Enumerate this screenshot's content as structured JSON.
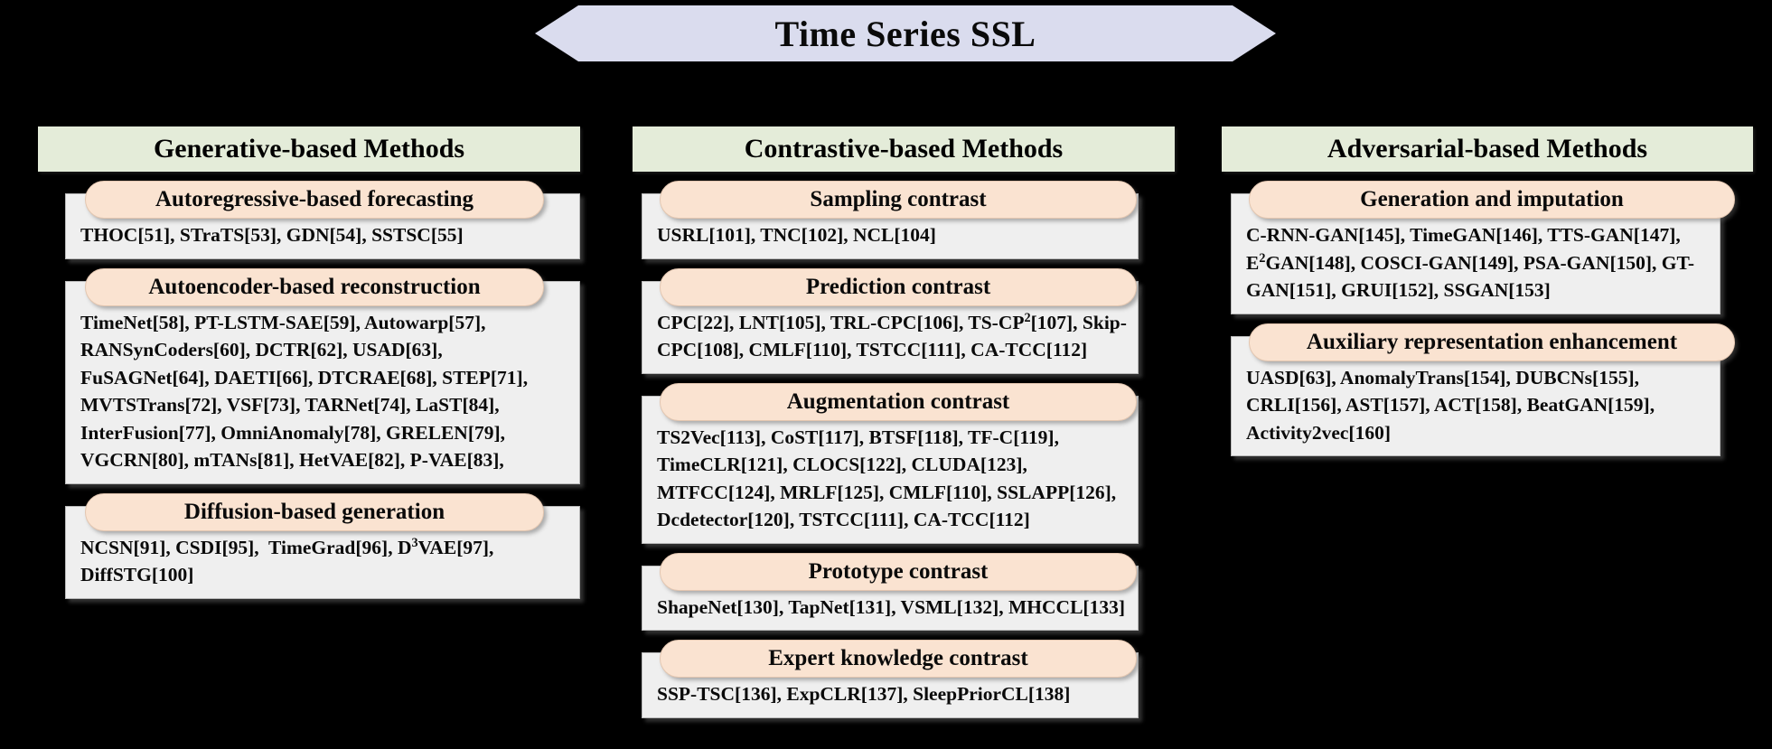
{
  "title": {
    "text": "Time Series SSL",
    "fill_color": "#dadcee"
  },
  "colors": {
    "header_green": "#e4ecd9",
    "pill_peach": "#fae3d1",
    "body_gray": "#efefef",
    "background": "#000000",
    "text": "#0a0a0a"
  },
  "columns": [
    {
      "id": "generative",
      "header": "Generative-based Methods",
      "blocks": [
        {
          "label": "Autoregressive-based forecasting",
          "items_html": "THOC[51], STraTS[53], GDN[54], SSTSC[55]",
          "items": [
            "THOC[51]",
            "STraTS[53]",
            "GDN[54]",
            "SSTSC[55]"
          ]
        },
        {
          "label": "Autoencoder-based reconstruction",
          "items_html": "TimeNet[58], PT-LSTM-SAE[59], Autowarp[57], RANSynCoders[60], DCTR[62], USAD[63], FuSAGNet[64], DAETI[66], DTCRAE[68], STEP[71], MVTSTrans[72], VSF[73], TARNet[74], LaST[84], InterFusion[77], OmniAnomaly[78], GRELEN[79], VGCRN[80], mTANs[81], HetVAE[82], P-VAE[83],",
          "items": [
            "TimeNet[58]",
            "PT-LSTM-SAE[59]",
            "Autowarp[57]",
            "RANSynCoders[60]",
            "DCTR[62]",
            "USAD[63]",
            "FuSAGNet[64]",
            "DAETI[66]",
            "DTCRAE[68]",
            "STEP[71]",
            "MVTSTrans[72]",
            "VSF[73]",
            "TARNet[74]",
            "LaST[84]",
            "InterFusion[77]",
            "OmniAnomaly[78]",
            "GRELEN[79]",
            "VGCRN[80]",
            "mTANs[81]",
            "HetVAE[82]",
            "P-VAE[83]"
          ]
        },
        {
          "label": "Diffusion-based generation",
          "items_html": "NCSN[91], CSDI[95],&nbsp; TimeGrad[96], D<sup>3</sup>VAE[97], DiffSTG[100]",
          "items": [
            "NCSN[91]",
            "CSDI[95]",
            "TimeGrad[96]",
            "D3VAE[97]",
            "DiffSTG[100]"
          ]
        }
      ]
    },
    {
      "id": "contrastive",
      "header": "Contrastive-based Methods",
      "blocks": [
        {
          "label": "Sampling contrast",
          "items_html": "USRL[101], TNC[102], NCL[104]",
          "items": [
            "USRL[101]",
            "TNC[102]",
            "NCL[104]"
          ]
        },
        {
          "label": "Prediction contrast",
          "items_html": "CPC[22], LNT[105], TRL-CPC[106], TS-CP<sup>2</sup>[107], Skip-CPC[108], CMLF[110], TSTCC[111], CA-TCC[112]",
          "items": [
            "CPC[22]",
            "LNT[105]",
            "TRL-CPC[106]",
            "TS-CP2[107]",
            "Skip-CPC[108]",
            "CMLF[110]",
            "TSTCC[111]",
            "CA-TCC[112]"
          ]
        },
        {
          "label": "Augmentation contrast",
          "items_html": "TS2Vec[113], CoST[117], BTSF[118], TF-C[119], TimeCLR[121], CLOCS[122], CLUDA[123], MTFCC[124], MRLF[125], CMLF[110], SSLAPP[126], Dcdetector[120], TSTCC[111], CA-TCC[112]",
          "items": [
            "TS2Vec[113]",
            "CoST[117]",
            "BTSF[118]",
            "TF-C[119]",
            "TimeCLR[121]",
            "CLOCS[122]",
            "CLUDA[123]",
            "MTFCC[124]",
            "MRLF[125]",
            "CMLF[110]",
            "SSLAPP[126]",
            "Dcdetector[120]",
            "TSTCC[111]",
            "CA-TCC[112]"
          ]
        },
        {
          "label": "Prototype contrast",
          "items_html": "ShapeNet[130], TapNet[131], VSML[132], MHCCL[133]",
          "items": [
            "ShapeNet[130]",
            "TapNet[131]",
            "VSML[132]",
            "MHCCL[133]"
          ]
        },
        {
          "label": "Expert knowledge contrast",
          "items_html": "SSP-TSC[136], ExpCLR[137], SleepPriorCL[138]",
          "items": [
            "SSP-TSC[136]",
            "ExpCLR[137]",
            "SleepPriorCL[138]"
          ]
        }
      ]
    },
    {
      "id": "adversarial",
      "header": "Adversarial-based Methods",
      "blocks": [
        {
          "label": "Generation and imputation",
          "items_html": "C-RNN-GAN[145], TimeGAN[146], TTS-GAN[147], E<sup>2</sup>GAN[148], COSCI-GAN[149], PSA-GAN[150], GT-GAN[151], GRUI[152], SSGAN[153]",
          "items": [
            "C-RNN-GAN[145]",
            "TimeGAN[146]",
            "TTS-GAN[147]",
            "E2GAN[148]",
            "COSCI-GAN[149]",
            "PSA-GAN[150]",
            "GT-GAN[151]",
            "GRUI[152]",
            "SSGAN[153]"
          ]
        },
        {
          "label": "Auxiliary representation enhancement",
          "items_html": "UASD[63], AnomalyTrans[154], DUBCNs[155], CRLI[156], AST[157], ACT[158], BeatGAN[159], Activity2vec[160]",
          "items": [
            "UASD[63]",
            "AnomalyTrans[154]",
            "DUBCNs[155]",
            "CRLI[156]",
            "AST[157]",
            "ACT[158]",
            "BeatGAN[159]",
            "Activity2vec[160]"
          ]
        }
      ]
    }
  ]
}
